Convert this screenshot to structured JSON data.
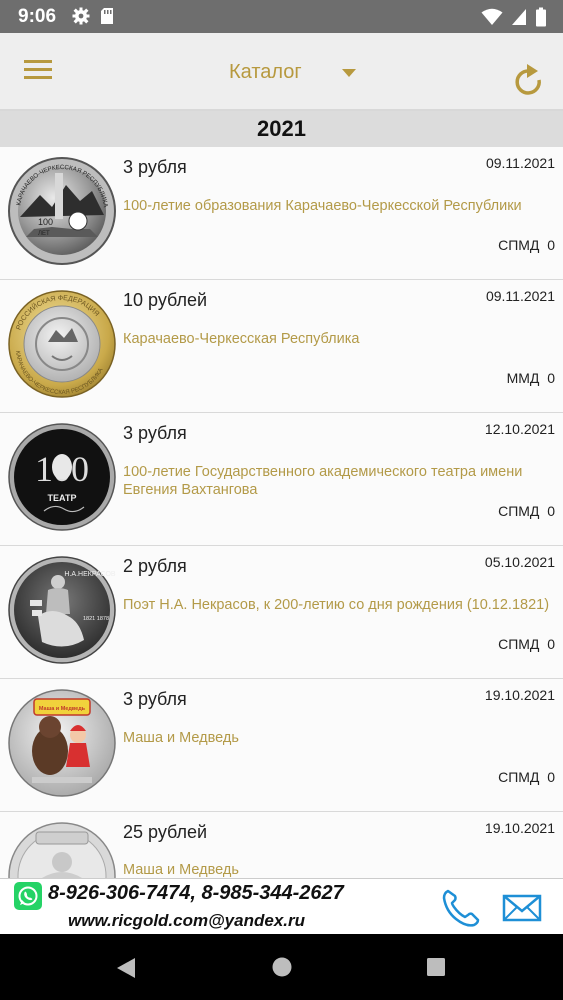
{
  "status_bar": {
    "time": "9:06",
    "icons": [
      "gear-icon",
      "sd-card-icon",
      "wifi-icon",
      "signal-icon",
      "battery-icon"
    ]
  },
  "app_bar": {
    "title": "Каталог",
    "icons": [
      "menu-icon",
      "dropdown-arrow-icon",
      "refresh-icon"
    ]
  },
  "year": "2021",
  "items": [
    {
      "denomination": "3 рубля",
      "date": "09.11.2021",
      "description": "100-летие образования Карачаево-Черкесской Республики",
      "mint": "СПМД",
      "count": "0"
    },
    {
      "denomination": "10 рублей",
      "date": "09.11.2021",
      "description": "Карачаево-Черкесская Республика",
      "mint": "ММД",
      "count": "0"
    },
    {
      "denomination": "3 рубля",
      "date": "12.10.2021",
      "description": "100-летие Государственного академического театра имени Евгения Вахтангова",
      "mint": "СПМД",
      "count": "0"
    },
    {
      "denomination": "2 рубля",
      "date": "05.10.2021",
      "description": "Поэт Н.А. Некрасов, к 200-летию со дня рождения (10.12.1821)",
      "mint": "СПМД",
      "count": "0"
    },
    {
      "denomination": "3 рубля",
      "date": "19.10.2021",
      "description": "Маша и Медведь",
      "mint": "СПМД",
      "count": "0"
    },
    {
      "denomination": "25 рублей",
      "date": "19.10.2021",
      "description": "Маша и Медведь",
      "mint": "",
      "count": ""
    }
  ],
  "coin_text": {
    "coin1_rim": "КАРАЧАЕВО-ЧЕРКЕССКАЯ РЕСПУБЛИКА",
    "coin1_center": "100",
    "coin1_sub": "ЛЕТ",
    "coin2_rim_top": "РОССИЙСКАЯ ФЕДЕРАЦИЯ",
    "coin2_rim_bottom": "КАРАЧАЕВО-ЧЕРКЕССКАЯ РЕСПУБЛИКА",
    "coin3_big": "100",
    "coin3_sub": "ТЕАТР",
    "coin4_name": "Н.А.НЕКРАСОВ",
    "coin4_years": "1821 1878",
    "coin5_logo": "Маша и Медведь"
  },
  "footer": {
    "phones": "8-926-306-7474, 8-985-344-2627",
    "email": "www.ricgold.com@yandex.ru",
    "icons": [
      "whatsapp-icon",
      "phone-icon",
      "mail-icon"
    ]
  },
  "nav_bar": {
    "icons": [
      "back-icon",
      "home-icon",
      "recent-apps-icon"
    ]
  },
  "colors": {
    "accent": "#b7993e",
    "description": "#b39a48",
    "status_bar": "#6e6e6e",
    "app_bar": "#eeeeee"
  }
}
